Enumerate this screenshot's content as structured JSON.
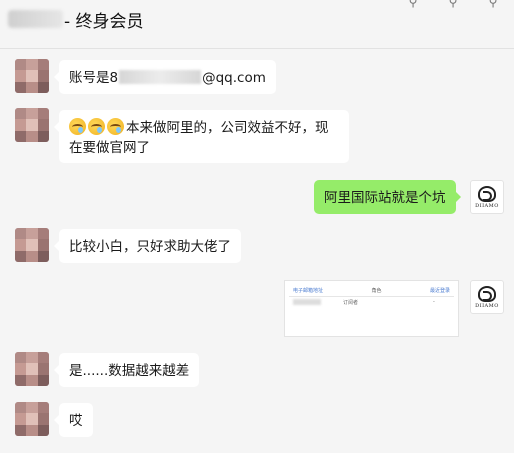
{
  "header": {
    "title_suffix": "- 终身会员",
    "icons": [
      "pin-icon",
      "minimize-icon",
      "maximize-icon"
    ]
  },
  "messages": [
    {
      "side": "left",
      "prefix": "账号是8",
      "suffix": "@qq.com"
    },
    {
      "side": "left",
      "line1": "本来做阿里的，公司效益不好，现",
      "line2": "在要做官网了",
      "emoji_count": 3
    },
    {
      "side": "right",
      "text": "阿里国际站就是个坑"
    },
    {
      "side": "left",
      "text": "比较小白，只好求助大佬了"
    },
    {
      "side": "right",
      "type": "image",
      "image": {
        "col1": "电子邮箱地址",
        "col2": "角色",
        "col3": "最近登录",
        "row_role": "订阅者",
        "row_last": "-"
      }
    },
    {
      "side": "left",
      "text": "是......数据越来越差"
    },
    {
      "side": "left",
      "text": "哎"
    }
  ],
  "right_avatar": {
    "logo_text": "DIIAMO"
  },
  "colors": {
    "bubble_left": "#ffffff",
    "bubble_right": "#95ec69",
    "background": "#f5f5f5"
  }
}
